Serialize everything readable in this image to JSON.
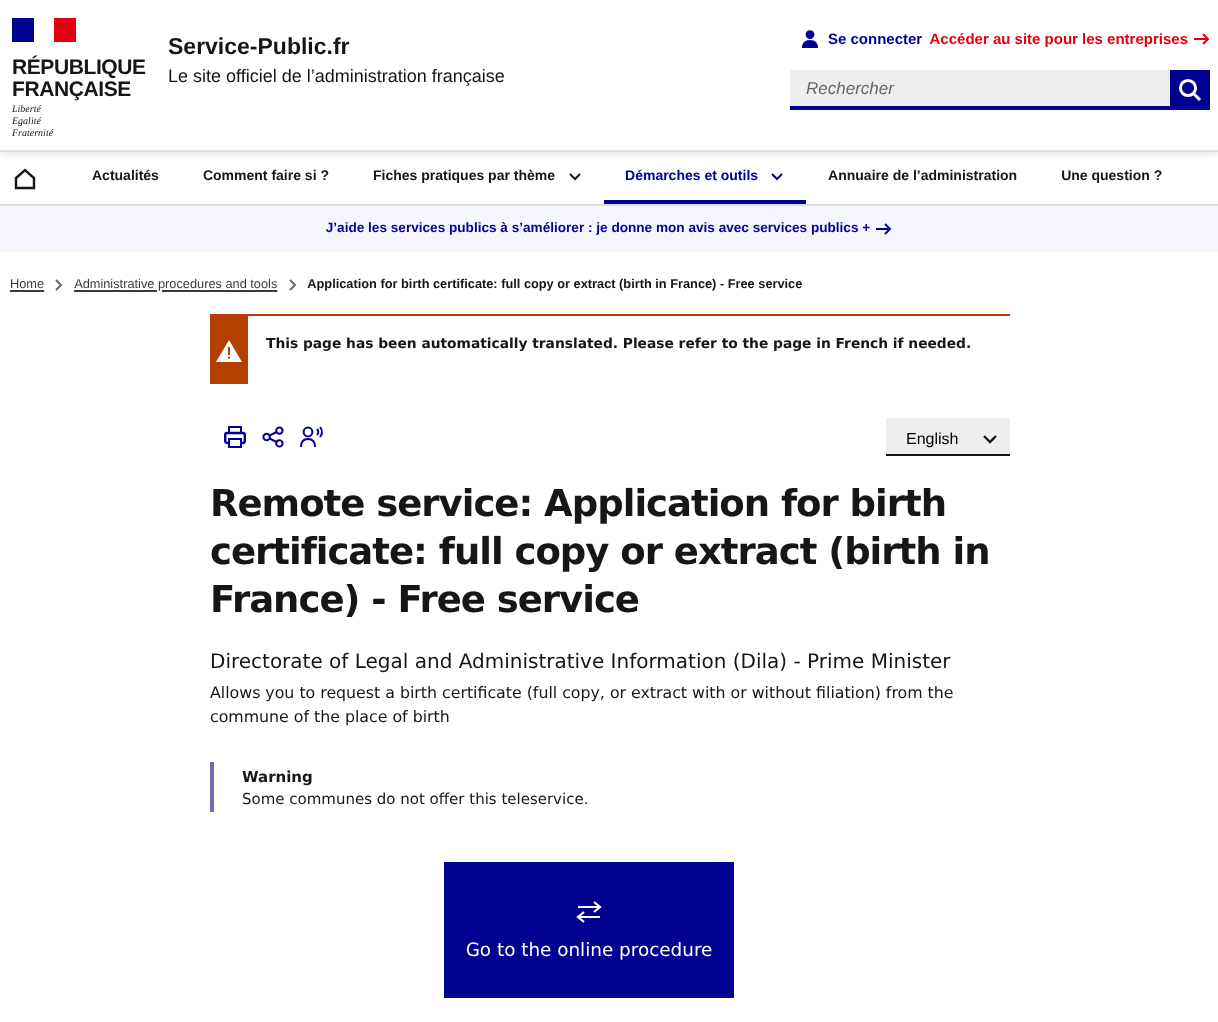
{
  "header": {
    "logo_lines": [
      "RÉPUBLIQUE",
      "FRANÇAISE"
    ],
    "motto": [
      "Liberté",
      "Egalité",
      "Fraternité"
    ],
    "site_name": "Service-Public.fr",
    "tagline": "Le site officiel de l’administration française",
    "login": "Se connecter",
    "business_link": "Accéder au site pour les entreprises",
    "search": {
      "placeholder": "Rechercher"
    }
  },
  "nav": [
    {
      "label": "Actualités",
      "selected": false,
      "has_menu": false
    },
    {
      "label": "Comment faire si ?",
      "selected": false,
      "has_menu": false
    },
    {
      "label": "Fiches pratiques par thème",
      "selected": false,
      "has_menu": true
    },
    {
      "label": "Démarches et outils",
      "selected": true,
      "has_menu": true
    },
    {
      "label": "Annuaire de l’administration",
      "selected": false,
      "has_menu": false
    },
    {
      "label": "Une question ?",
      "selected": false,
      "has_menu": false
    }
  ],
  "feedback_banner": "J’aide les services publics à s’améliorer : je donne mon avis avec services publics +",
  "breadcrumb": [
    {
      "label": "Home",
      "link": true
    },
    {
      "label": "Administrative procedures and tools",
      "link": true
    },
    {
      "label": "Application for birth certificate: full copy or extract (birth in France) - Free service",
      "link": false
    }
  ],
  "alert": "This page has been automatically translated. Please refer to the page in French if needed.",
  "language": "English",
  "title": "Remote service: Application for birth certificate: full copy or extract (birth in France) - Free service",
  "author": "Directorate of Legal and Administrative Information (Dila) - Prime Minister",
  "description": "Allows you to request a birth certificate (full copy, or extract with or without filiation) from the commune of the place of birth",
  "warning": {
    "title": "Warning",
    "text": "Some communes do not offer this teleservice."
  },
  "cta": "Go to the online procedure"
}
